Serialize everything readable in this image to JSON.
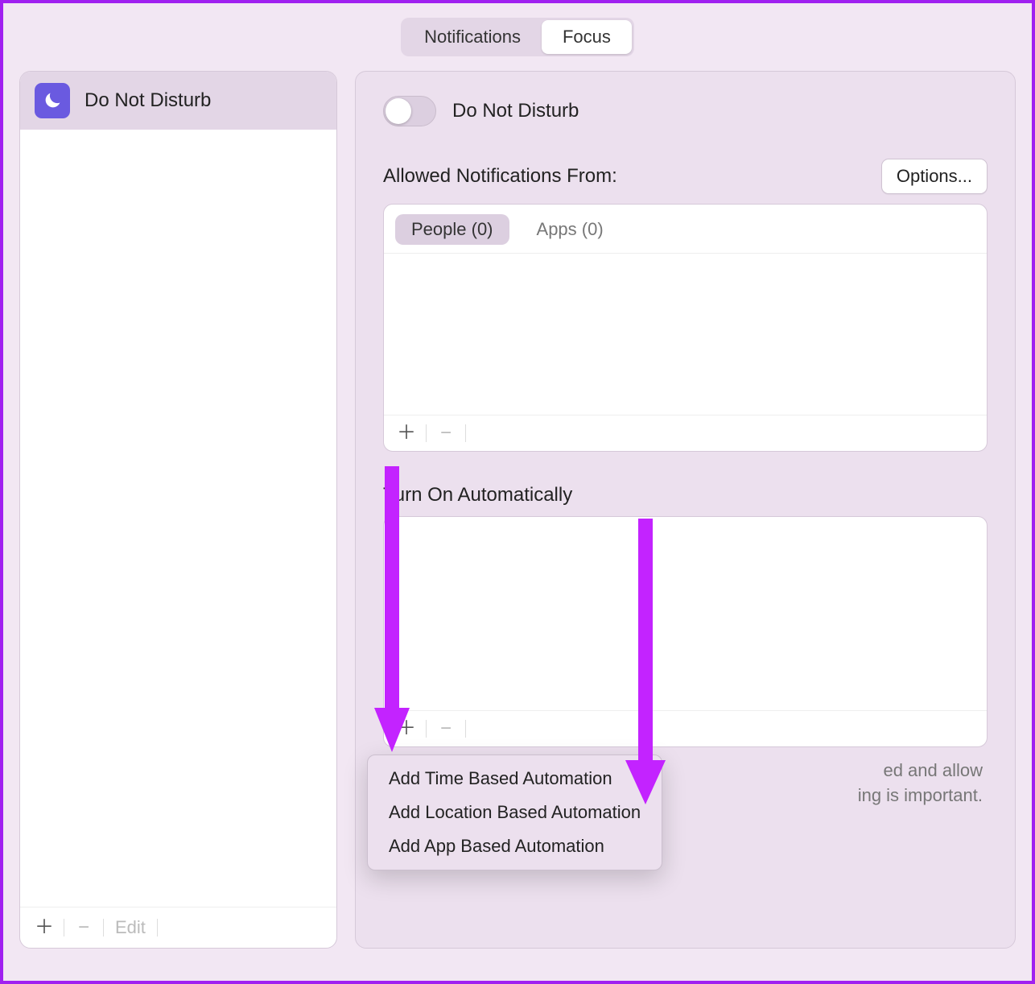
{
  "tabs": {
    "notifications": "Notifications",
    "focus": "Focus"
  },
  "sidebar": {
    "items": [
      {
        "label": "Do Not Disturb"
      }
    ],
    "edit": "Edit"
  },
  "main": {
    "toggle_label": "Do Not Disturb",
    "allowed_title": "Allowed Notifications From:",
    "options_label": "Options...",
    "tabs": {
      "people": "People (0)",
      "apps": "Apps (0)"
    },
    "auto_title": "Turn On Automatically",
    "desc_tail_1": "ed and allow",
    "desc_tail_2": "ing is important."
  },
  "menu": {
    "items": [
      "Add Time Based Automation",
      "Add Location Based Automation",
      "Add App Based Automation"
    ]
  }
}
